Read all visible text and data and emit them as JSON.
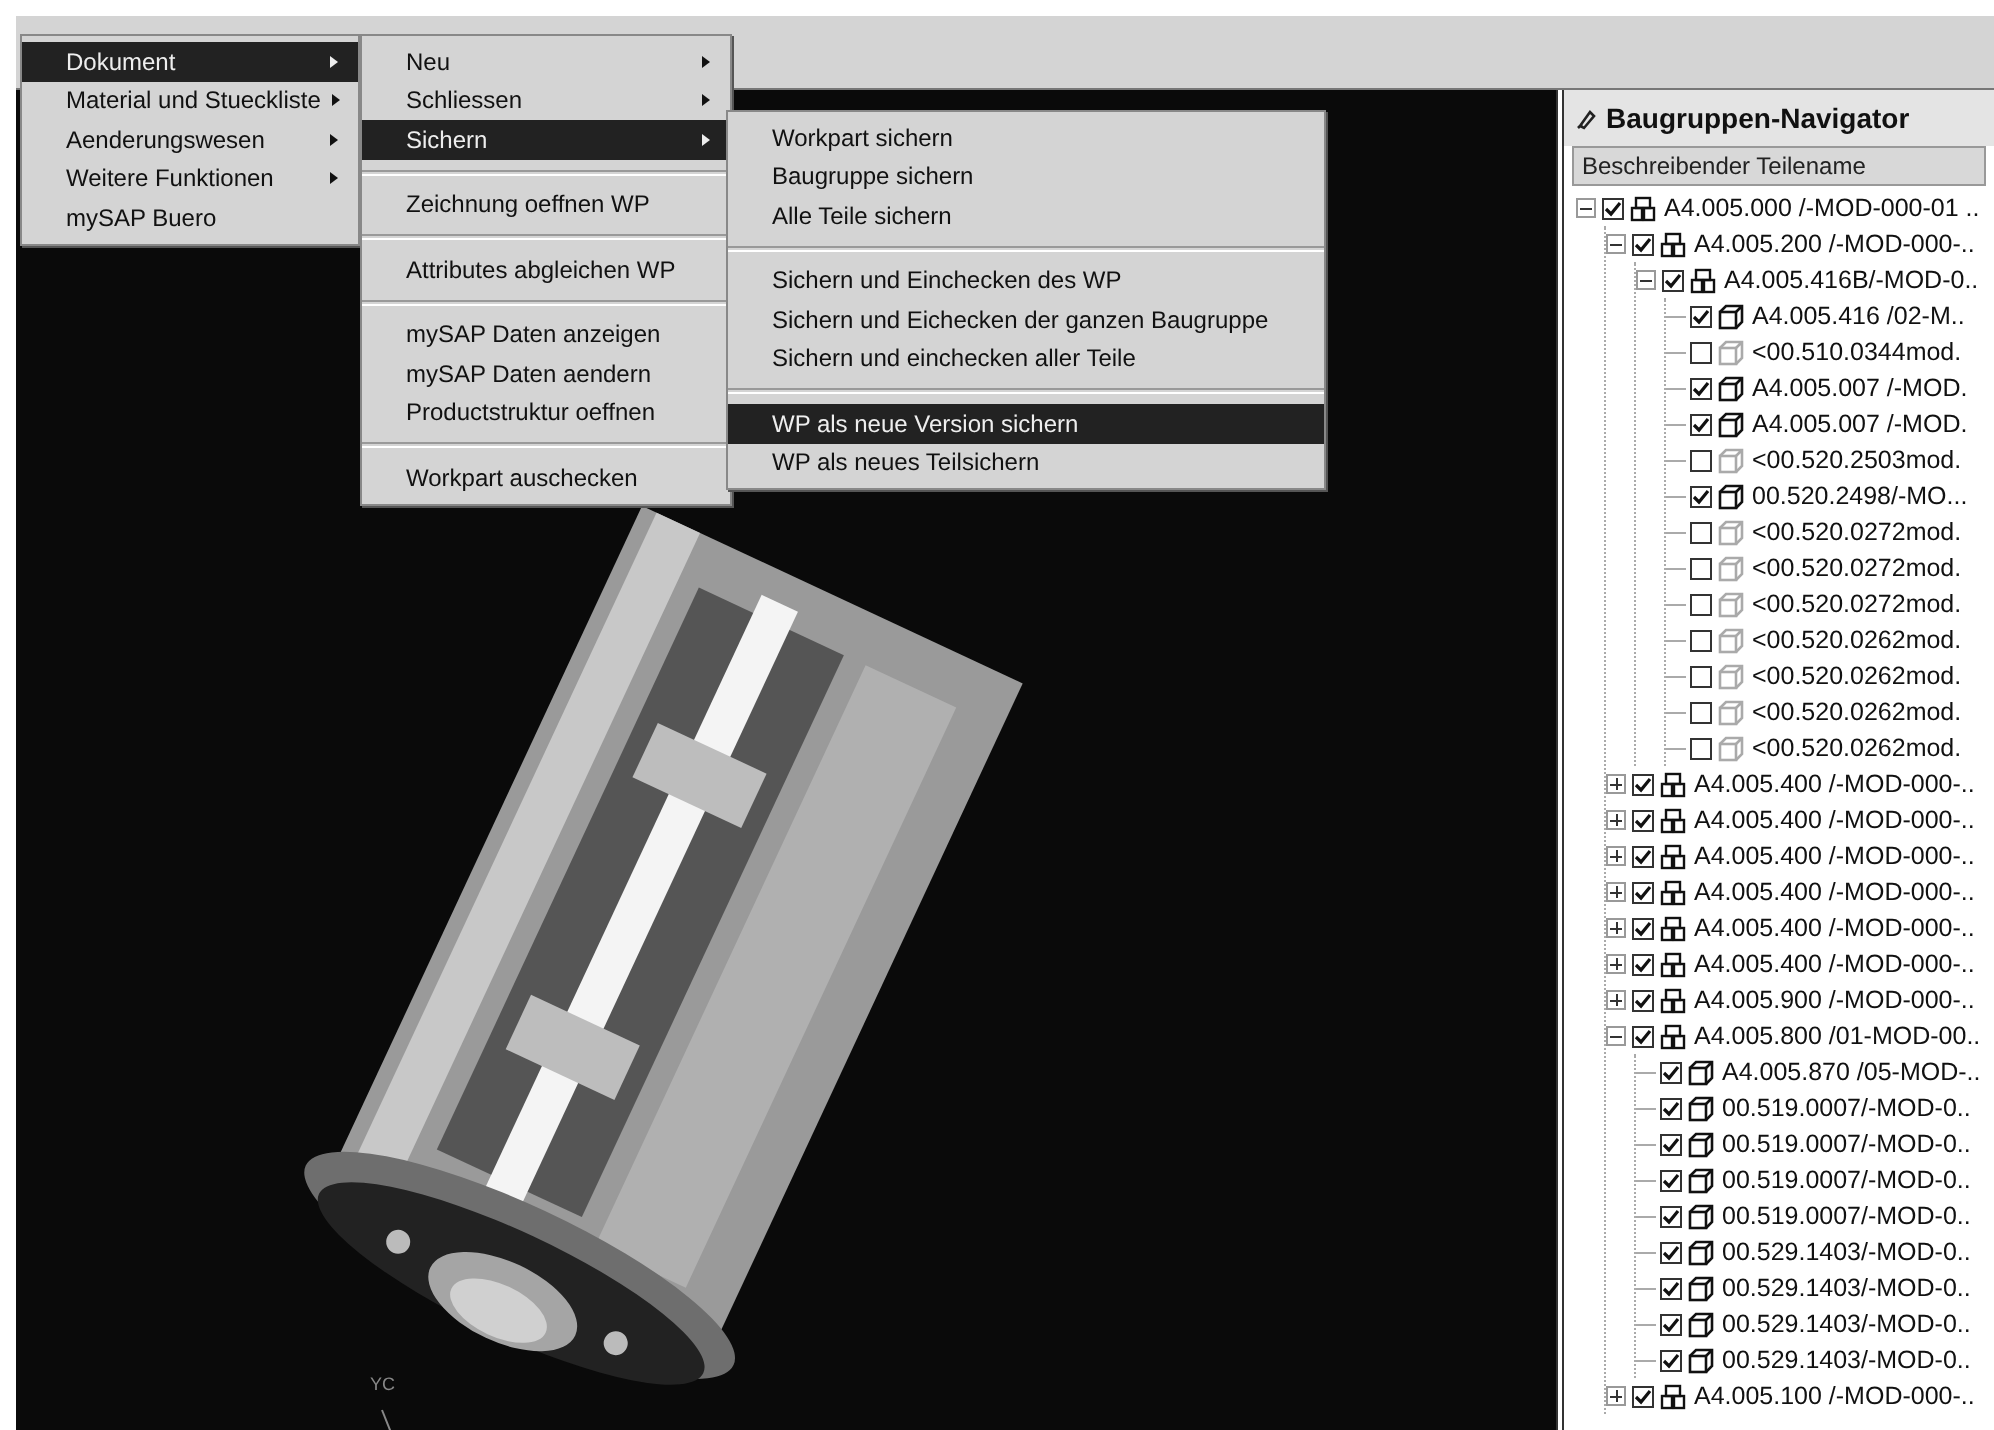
{
  "main_menu": {
    "items": [
      {
        "label": "Dokument",
        "submenu": true,
        "selected": true
      },
      {
        "label": "Material und Stueckliste",
        "submenu": true,
        "selected": false
      },
      {
        "label": "Aenderungswesen",
        "submenu": true,
        "selected": false
      },
      {
        "label": "Weitere Funktionen",
        "submenu": true,
        "selected": false
      },
      {
        "label": "mySAP Buero",
        "submenu": false,
        "selected": false
      }
    ]
  },
  "document_menu": {
    "items": [
      {
        "kind": "item",
        "label": "Neu",
        "submenu": true,
        "selected": false
      },
      {
        "kind": "item",
        "label": "Schliessen",
        "submenu": true,
        "selected": false
      },
      {
        "kind": "item",
        "label": "Sichern",
        "submenu": true,
        "selected": true
      },
      {
        "kind": "separator"
      },
      {
        "kind": "item",
        "label": "Zeichnung oeffnen WP",
        "submenu": false,
        "selected": false
      },
      {
        "kind": "separator"
      },
      {
        "kind": "item",
        "label": "Attributes abgleichen WP",
        "submenu": false,
        "selected": false
      },
      {
        "kind": "separator"
      },
      {
        "kind": "item",
        "label": "mySAP Daten anzeigen",
        "submenu": false,
        "selected": false
      },
      {
        "kind": "item",
        "label": "mySAP Daten aendern",
        "submenu": false,
        "selected": false
      },
      {
        "kind": "item",
        "label": "Productstruktur oeffnen",
        "submenu": false,
        "selected": false
      },
      {
        "kind": "separator"
      },
      {
        "kind": "item",
        "label": "Workpart auschecken",
        "submenu": false,
        "selected": false
      }
    ]
  },
  "save_menu": {
    "items": [
      {
        "kind": "item",
        "label": "Workpart sichern",
        "submenu": false,
        "selected": false
      },
      {
        "kind": "item",
        "label": "Baugruppe sichern",
        "submenu": false,
        "selected": false
      },
      {
        "kind": "item",
        "label": "Alle Teile sichern",
        "submenu": false,
        "selected": false
      },
      {
        "kind": "separator"
      },
      {
        "kind": "item",
        "label": "Sichern und Einchecken des WP",
        "submenu": false,
        "selected": false
      },
      {
        "kind": "item",
        "label": "Sichern und Eichecken der ganzen Baugruppe",
        "submenu": false,
        "selected": false
      },
      {
        "kind": "item",
        "label": "Sichern und einchecken aller Teile",
        "submenu": false,
        "selected": false
      },
      {
        "kind": "separator"
      },
      {
        "kind": "item",
        "label": "WP als neue Version sichern",
        "submenu": false,
        "selected": true
      },
      {
        "kind": "item",
        "label": "WP als neues Teilsichern",
        "submenu": false,
        "selected": false
      }
    ]
  },
  "viewport": {
    "axis_label": "YC"
  },
  "navigator": {
    "title": "Baugruppen-Navigator",
    "column": "Beschreibender Teilename",
    "tree": [
      {
        "kind": "assembly",
        "label": "A4.005.000 /-MOD-000-01 ..",
        "checked": true,
        "expanded": true,
        "children": [
          {
            "kind": "assembly",
            "label": "A4.005.200 /-MOD-000-..",
            "checked": true,
            "expanded": true,
            "children": [
              {
                "kind": "assembly",
                "label": "A4.005.416B/-MOD-0..",
                "checked": true,
                "expanded": true,
                "children": [
                  {
                    "kind": "part",
                    "label": "A4.005.416 /02-M..",
                    "checked": true
                  },
                  {
                    "kind": "part",
                    "label": "<00.510.0344mod.",
                    "checked": false
                  },
                  {
                    "kind": "part",
                    "label": "A4.005.007 /-MOD.",
                    "checked": true
                  },
                  {
                    "kind": "part",
                    "label": "A4.005.007 /-MOD.",
                    "checked": true
                  },
                  {
                    "kind": "part",
                    "label": "<00.520.2503mod.",
                    "checked": false
                  },
                  {
                    "kind": "part",
                    "label": "00.520.2498/-MO...",
                    "checked": true
                  },
                  {
                    "kind": "part",
                    "label": "<00.520.0272mod.",
                    "checked": false
                  },
                  {
                    "kind": "part",
                    "label": "<00.520.0272mod.",
                    "checked": false
                  },
                  {
                    "kind": "part",
                    "label": "<00.520.0272mod.",
                    "checked": false
                  },
                  {
                    "kind": "part",
                    "label": "<00.520.0262mod.",
                    "checked": false
                  },
                  {
                    "kind": "part",
                    "label": "<00.520.0262mod.",
                    "checked": false
                  },
                  {
                    "kind": "part",
                    "label": "<00.520.0262mod.",
                    "checked": false
                  },
                  {
                    "kind": "part",
                    "label": "<00.520.0262mod.",
                    "checked": false
                  }
                ]
              }
            ]
          },
          {
            "kind": "assembly",
            "label": "A4.005.400 /-MOD-000-..",
            "checked": true,
            "expanded": false
          },
          {
            "kind": "assembly",
            "label": "A4.005.400 /-MOD-000-..",
            "checked": true,
            "expanded": false
          },
          {
            "kind": "assembly",
            "label": "A4.005.400 /-MOD-000-..",
            "checked": true,
            "expanded": false
          },
          {
            "kind": "assembly",
            "label": "A4.005.400 /-MOD-000-..",
            "checked": true,
            "expanded": false
          },
          {
            "kind": "assembly",
            "label": "A4.005.400 /-MOD-000-..",
            "checked": true,
            "expanded": false
          },
          {
            "kind": "assembly",
            "label": "A4.005.400 /-MOD-000-..",
            "checked": true,
            "expanded": false
          },
          {
            "kind": "assembly",
            "label": "A4.005.900 /-MOD-000-..",
            "checked": true,
            "expanded": false
          },
          {
            "kind": "assembly",
            "label": "A4.005.800 /01-MOD-00..",
            "checked": true,
            "expanded": true,
            "children": [
              {
                "kind": "part",
                "label": "A4.005.870 /05-MOD-..",
                "checked": true
              },
              {
                "kind": "part",
                "label": "00.519.0007/-MOD-0..",
                "checked": true
              },
              {
                "kind": "part",
                "label": "00.519.0007/-MOD-0..",
                "checked": true
              },
              {
                "kind": "part",
                "label": "00.519.0007/-MOD-0..",
                "checked": true
              },
              {
                "kind": "part",
                "label": "00.519.0007/-MOD-0..",
                "checked": true
              },
              {
                "kind": "part",
                "label": "00.529.1403/-MOD-0..",
                "checked": true
              },
              {
                "kind": "part",
                "label": "00.529.1403/-MOD-0..",
                "checked": true
              },
              {
                "kind": "part",
                "label": "00.529.1403/-MOD-0..",
                "checked": true
              },
              {
                "kind": "part",
                "label": "00.529.1403/-MOD-0..",
                "checked": true
              }
            ]
          },
          {
            "kind": "assembly",
            "label": "A4.005.100 /-MOD-000-..",
            "checked": true,
            "expanded": false
          }
        ]
      }
    ]
  }
}
